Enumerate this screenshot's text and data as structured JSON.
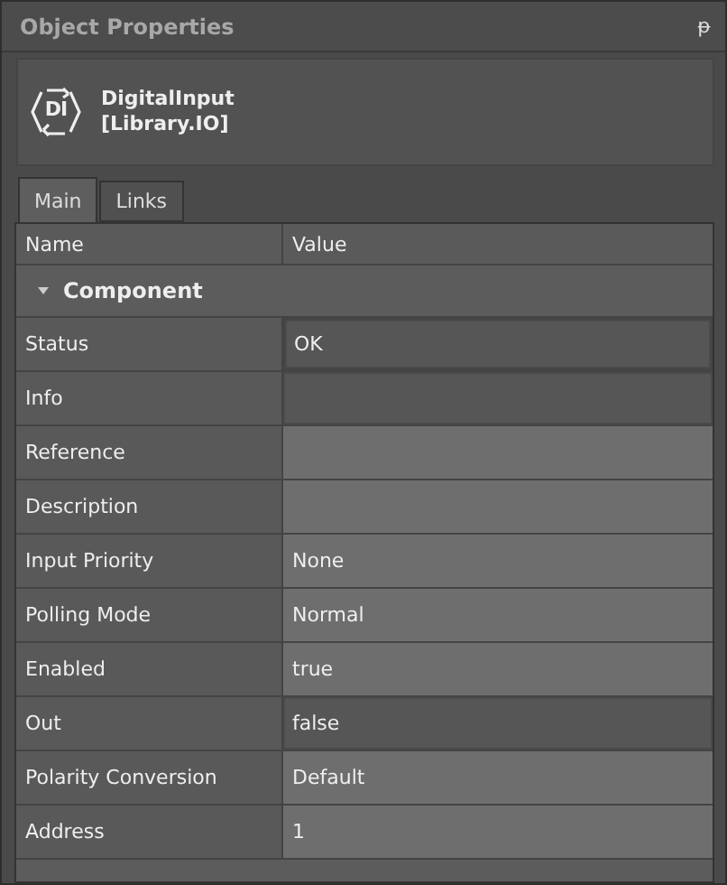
{
  "panel": {
    "title": "Object Properties",
    "pin": "ᵽ"
  },
  "object": {
    "icon_text": "DI",
    "name": "DigitalInput",
    "library": "[Library.IO]"
  },
  "tabs": [
    {
      "label": "Main",
      "selected": true
    },
    {
      "label": "Links",
      "selected": false
    }
  ],
  "table": {
    "columns": [
      "Name",
      "Value"
    ],
    "group": {
      "label": "Component",
      "expanded": true
    },
    "rows": [
      {
        "name": "Status",
        "value": "OK",
        "readonly": true
      },
      {
        "name": "Info",
        "value": "",
        "readonly": true
      },
      {
        "name": "Reference",
        "value": "",
        "readonly": false
      },
      {
        "name": "Description",
        "value": "",
        "readonly": false
      },
      {
        "name": "Input Priority",
        "value": "None",
        "readonly": false
      },
      {
        "name": "Polling Mode",
        "value": "Normal",
        "readonly": false
      },
      {
        "name": "Enabled",
        "value": "true",
        "readonly": false
      },
      {
        "name": "Out",
        "value": "false",
        "readonly": true
      },
      {
        "name": "Polarity Conversion",
        "value": "Default",
        "readonly": false
      },
      {
        "name": "Address",
        "value": "1",
        "readonly": false
      }
    ]
  }
}
